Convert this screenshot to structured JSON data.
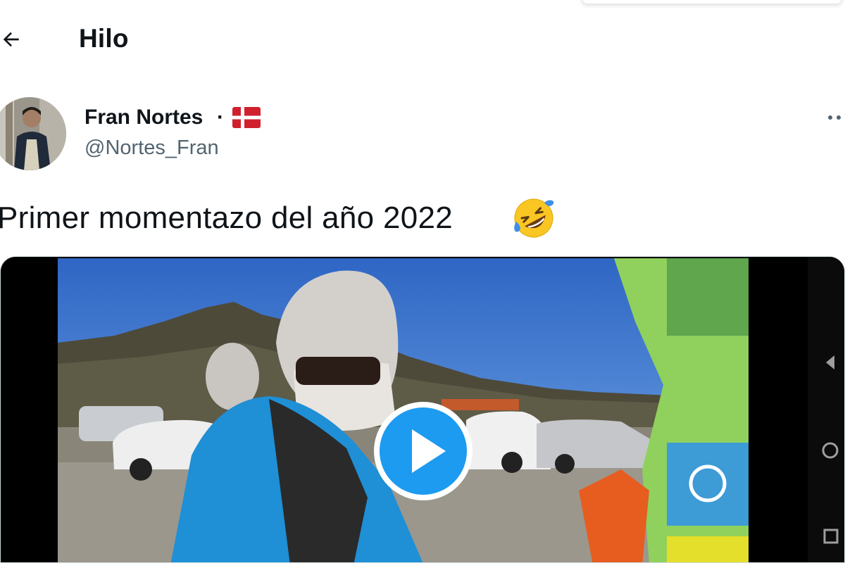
{
  "header": {
    "back_icon": "arrow-left-icon",
    "title": "Hilo"
  },
  "tweet": {
    "author_name": "Fran Nortes",
    "separator": "·",
    "flag_icon": "denmark-flag-icon",
    "handle": "@Nortes_Fran",
    "more_icon": "more-horizontal-icon",
    "text": "Primer momentazo del año 2022",
    "emoji_icon": "rolling-on-floor-laughing-emoji"
  },
  "media": {
    "type": "video",
    "play_icon": "play-icon"
  },
  "colors": {
    "text_primary": "#0f1419",
    "text_secondary": "#536471",
    "accent": "#1d9bf0"
  }
}
